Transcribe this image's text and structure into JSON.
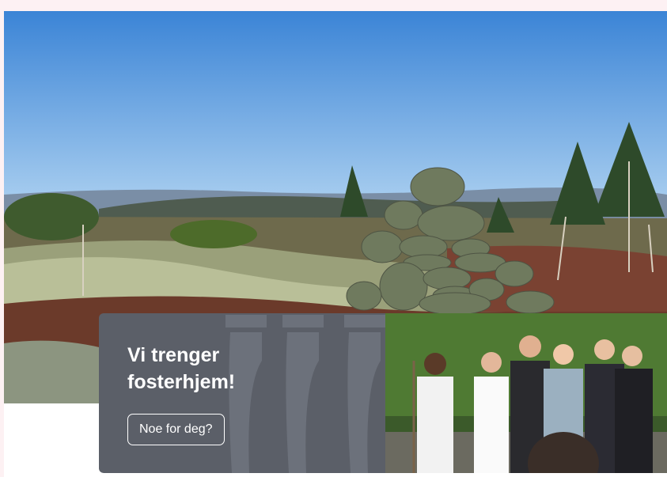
{
  "card": {
    "title": "Vi trenger fosterhjem!",
    "cta_label": "Noe for deg?"
  },
  "images": {
    "hero": "mountain-cairn-landscape",
    "group": "group-photo-people"
  },
  "colors": {
    "page_bg": "#fdf1f3",
    "card_bg": "#5b5f68",
    "sky": "#4a8ed8"
  }
}
